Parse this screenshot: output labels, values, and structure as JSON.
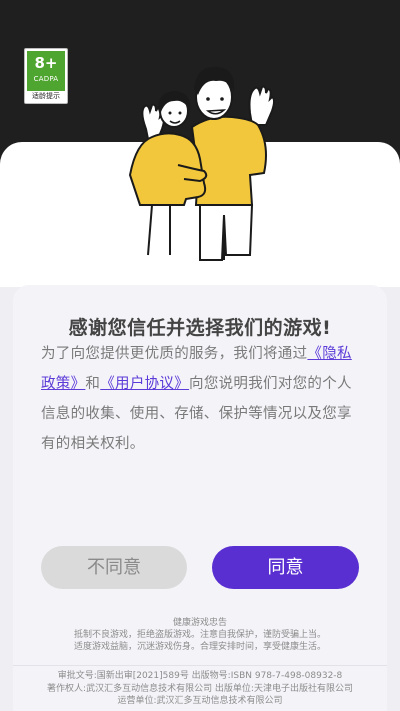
{
  "age_rating": {
    "age": "8+",
    "org": "CADPA",
    "tip": "适龄提示"
  },
  "dialog": {
    "title": "感谢您信任并选择我们的游戏!",
    "body_part1": "为了向您提供更优质的服务，我们将通过",
    "privacy_link": "《隐私政策》",
    "body_and": "和",
    "agreement_link": "《用户协议》",
    "body_part2": "向您说明我们对您的个人信息的收集、使用、存储、保护等情况以及您享有的相关权利。",
    "disagree_label": "不同意",
    "agree_label": "同意"
  },
  "footer": {
    "health_title": "健康游戏忠告",
    "health_line1": "抵制不良游戏，拒绝盗版游戏。注意自我保护，谨防受骗上当。",
    "health_line2": "适度游戏益脑，沉迷游戏伤身。合理安排时间，享受健康生活。",
    "approval_line": "审批文号:国新出审[2021]589号    出版物号:ISBN 978-7-498-08932-8",
    "copyright_line": "著作权人:武汉汇多互动信息技术有限公司    出版单位:天津电子出版社有限公司",
    "operator_line": "运营单位:武汉汇多互动信息技术有限公司"
  },
  "colors": {
    "accent": "#5a2fd1",
    "header_bg": "#1f1f1f",
    "badge_green": "#4ea52f",
    "illustration_yellow": "#f2c73c"
  }
}
